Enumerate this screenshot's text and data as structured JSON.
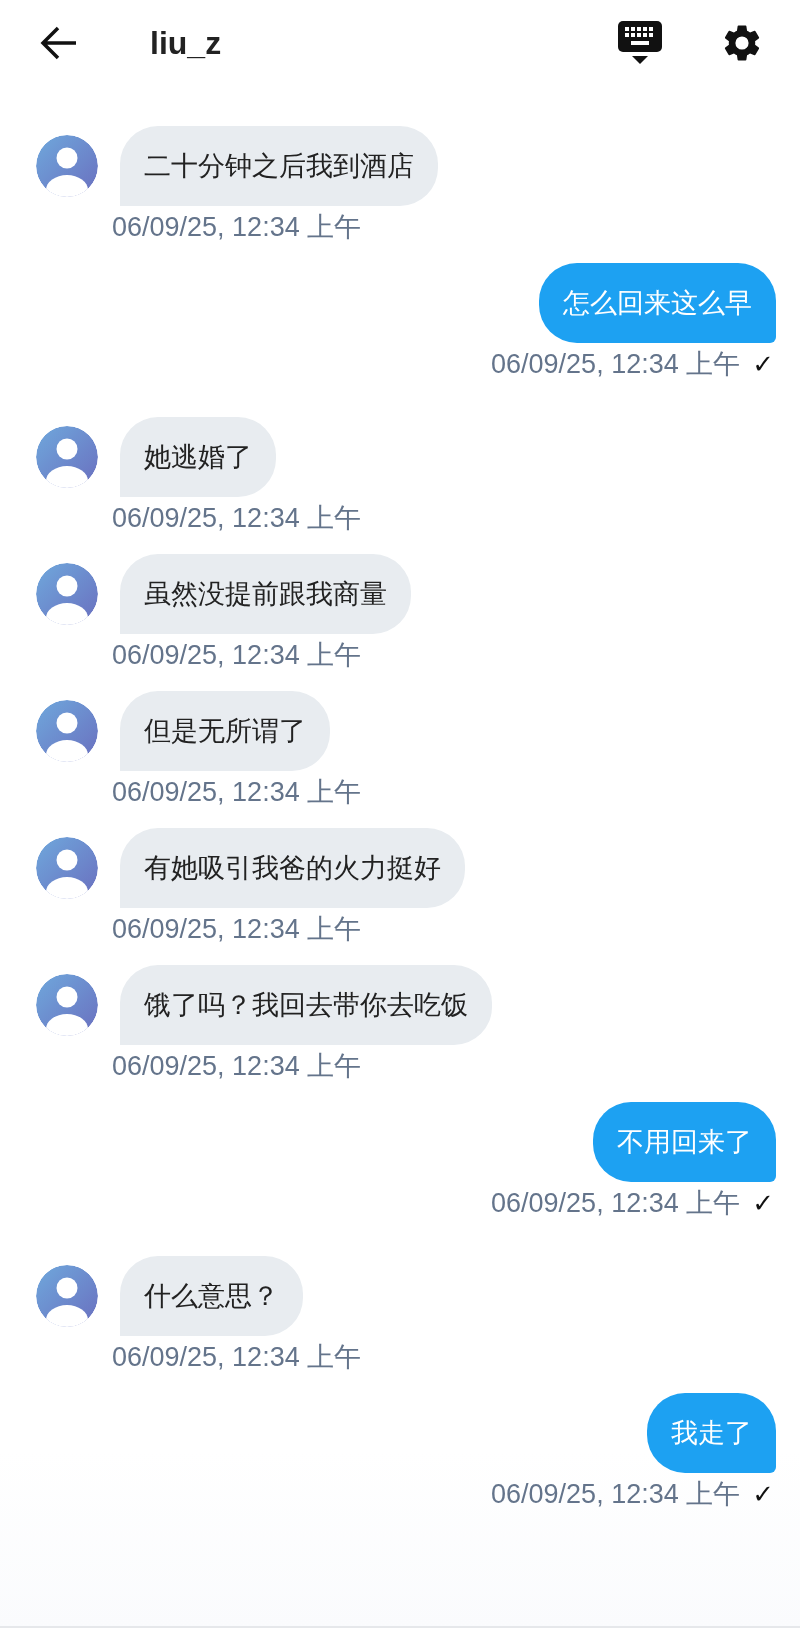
{
  "header": {
    "title": "liu_z"
  },
  "messages": [
    {
      "kind": "incoming",
      "text": "二十分钟之后我到酒店",
      "time": "06/09/25, 12:34 上午"
    },
    {
      "kind": "outgoing",
      "text": "怎么回来这么早",
      "time": "06/09/25, 12:34 上午",
      "tick": "✓"
    },
    {
      "kind": "incoming",
      "text": "她逃婚了",
      "time": "06/09/25, 12:34 上午"
    },
    {
      "kind": "incoming",
      "text": "虽然没提前跟我商量",
      "time": "06/09/25, 12:34 上午"
    },
    {
      "kind": "incoming",
      "text": "但是无所谓了",
      "time": "06/09/25, 12:34 上午"
    },
    {
      "kind": "incoming",
      "text": "有她吸引我爸的火力挺好",
      "time": "06/09/25, 12:34 上午"
    },
    {
      "kind": "incoming",
      "text": "饿了吗？我回去带你去吃饭",
      "time": "06/09/25, 12:34 上午"
    },
    {
      "kind": "outgoing",
      "text": "不用回来了",
      "time": "06/09/25, 12:34 上午",
      "tick": "✓"
    },
    {
      "kind": "incoming",
      "text": "什么意思？",
      "time": "06/09/25, 12:34 上午"
    },
    {
      "kind": "outgoing",
      "text": "我走了",
      "time": "06/09/25, 12:34 上午",
      "tick": "✓"
    }
  ]
}
